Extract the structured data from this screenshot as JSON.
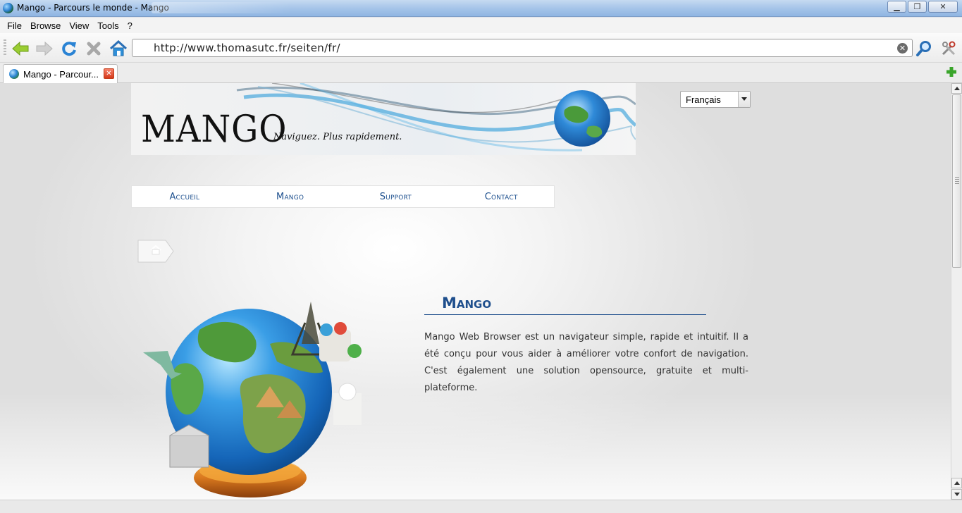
{
  "window": {
    "title": "Mango - Parcours le monde - Mango",
    "controls": {
      "minimize": "▁",
      "maximize": "❐",
      "close": "✕"
    }
  },
  "menu": {
    "items": [
      "File",
      "Browse",
      "View",
      "Tools",
      "?"
    ]
  },
  "toolbar": {
    "url": "http://www.thomasutc.fr/seiten/fr/",
    "buttons": [
      "back-icon",
      "forward-icon",
      "reload-icon",
      "stop-icon",
      "home-icon",
      "search-icon",
      "tools-icon"
    ]
  },
  "tabs": [
    {
      "title": "Mango - Parcour...",
      "active": true
    }
  ],
  "page": {
    "logo": "MANGO",
    "tagline": "Naviguez. Plus rapidement.",
    "language": "Français",
    "nav": [
      "Accueil",
      "Mango",
      "Support",
      "Contact"
    ],
    "section_title": "Mango",
    "description": "Mango Web Browser est un navigateur simple, rapide et intuitif. Il a été conçu pour vous aider à améliorer votre confort de navigation. C'est également une solution opensource, gratuite et multi-plateforme."
  },
  "colors": {
    "link_blue": "#1c4f8e",
    "heading_blue": "#1f4f8d",
    "titlebar": "#a9c7ea",
    "close_tab_red": "#d4381a",
    "add_tab_green": "#3aa52b"
  }
}
